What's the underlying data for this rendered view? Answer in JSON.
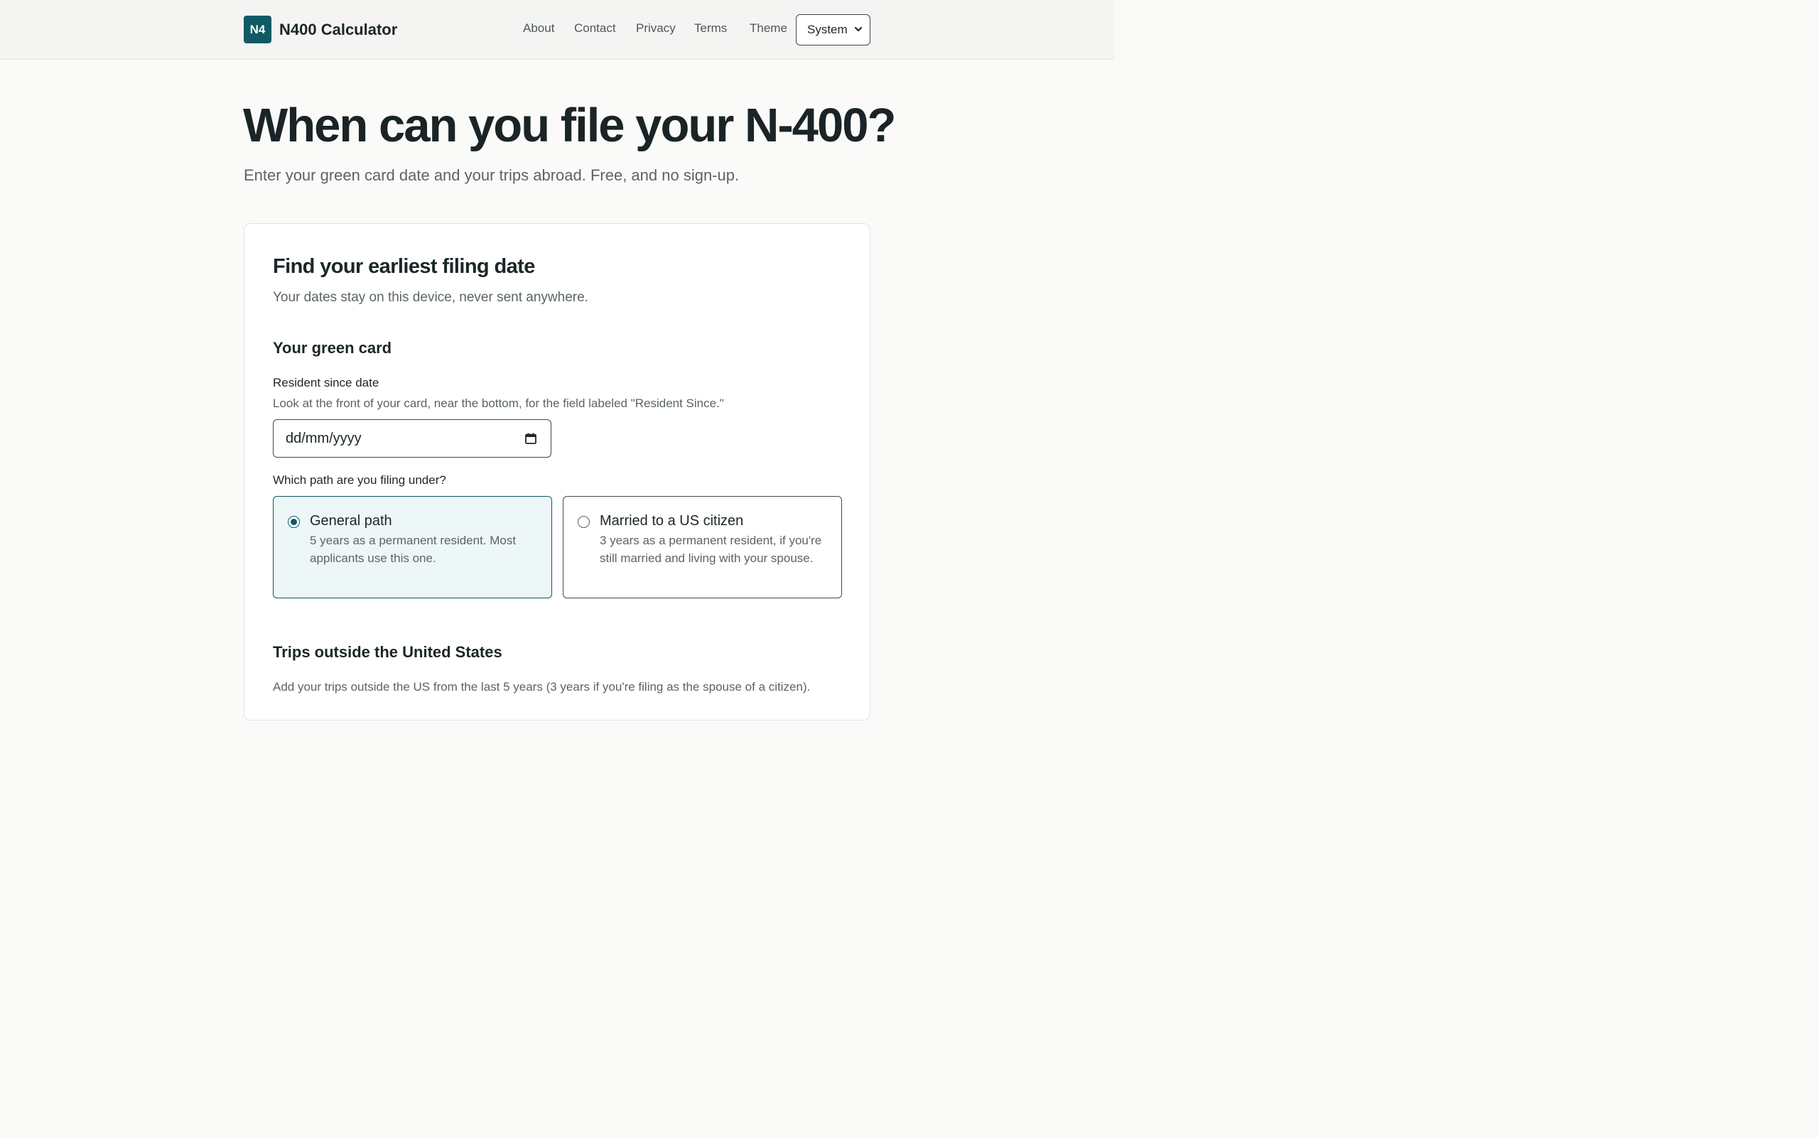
{
  "header": {
    "logo_text": "N4",
    "brand": "N400 Calculator",
    "nav": [
      "About",
      "Contact",
      "Privacy",
      "Terms"
    ],
    "theme_label": "Theme",
    "theme_value": "System",
    "accent_color": "#0f5a63"
  },
  "hero": {
    "title": "When can you file your N-400?",
    "subtitle": "Enter your green card date and your trips abroad. Free, and no sign-up."
  },
  "card": {
    "title": "Find your earliest filing date",
    "subtitle": "Your dates stay on this device, never sent anywhere.",
    "green_card": {
      "heading": "Your green card",
      "date_label": "Resident since date",
      "date_help": "Look at the front of your card, near the bottom, for the field labeled \"Resident Since.\"",
      "date_placeholder": "dd/mm/yyyy",
      "date_icon": "calendar-icon"
    },
    "path": {
      "label": "Which path are you filing under?",
      "options": [
        {
          "title": "General path",
          "desc": "5 years as a permanent resident. Most applicants use this one.",
          "selected": true
        },
        {
          "title": "Married to a US citizen",
          "desc": "3 years as a permanent resident, if you're still married and living with your spouse.",
          "selected": false
        }
      ]
    },
    "trips": {
      "heading": "Trips outside the United States",
      "help": "Add your trips outside the US from the last 5 years (3 years if you're filing as the spouse of a citizen)."
    }
  }
}
